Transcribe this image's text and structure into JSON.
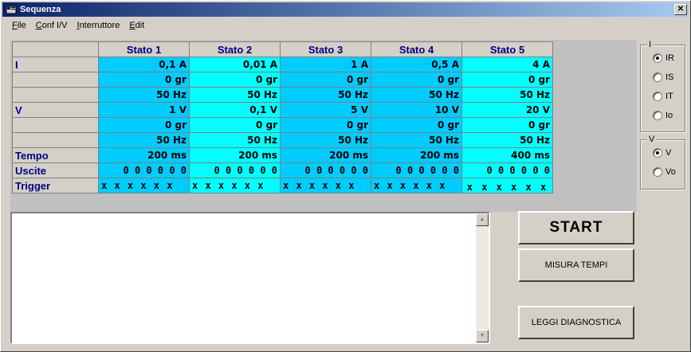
{
  "window": {
    "title": "Sequenza",
    "close_glyph": "✕"
  },
  "menu": [
    {
      "label": "File",
      "mnemonic": "F",
      "rest": "ile"
    },
    {
      "label": "Conf I/V",
      "mnemonic": "C",
      "rest": "onf I/V"
    },
    {
      "label": "Interruttore",
      "mnemonic": "I",
      "rest": "nterruttore"
    },
    {
      "label": "Edit",
      "mnemonic": "E",
      "rest": "dit"
    }
  ],
  "grid": {
    "headers": [
      "Stato 1",
      "Stato 2",
      "Stato 3",
      "Stato 4",
      "Stato 5"
    ],
    "rows": [
      {
        "label": "I",
        "values": [
          "0,1 A",
          "0,01 A",
          "1 A",
          "0,5 A",
          "4 A"
        ]
      },
      {
        "label": "",
        "values": [
          "0 gr",
          "0 gr",
          "0 gr",
          "0 gr",
          "0 gr"
        ]
      },
      {
        "label": "",
        "values": [
          "50 Hz",
          "50 Hz",
          "50 Hz",
          "50 Hz",
          "50 Hz"
        ]
      },
      {
        "label": "V",
        "values": [
          "1 V",
          "0,1 V",
          "5 V",
          "10 V",
          "20 V"
        ]
      },
      {
        "label": "",
        "values": [
          "0 gr",
          "0 gr",
          "0 gr",
          "0 gr",
          "0 gr"
        ]
      },
      {
        "label": "",
        "values": [
          "50 Hz",
          "50 Hz",
          "50 Hz",
          "50 Hz",
          "50 Hz"
        ]
      },
      {
        "label": "Tempo",
        "values": [
          "200 ms",
          "200 ms",
          "200 ms",
          "200 ms",
          "400 ms"
        ]
      },
      {
        "label": "Uscite",
        "values": [
          "0 0 0 0 0 0",
          "0 0 0 0 0 0",
          "0 0 0 0 0 0",
          "0 0 0 0 0 0",
          "0 0 0 0 0 0"
        ]
      },
      {
        "label": "Trigger",
        "values": [
          "x x x x x x",
          "x x x x x x",
          "x x x x x x",
          "x x x x x x",
          "x x x x x x"
        ]
      }
    ],
    "column_colors": [
      "#00ccff",
      "#00ffff",
      "#00ccff",
      "#00ccff",
      "#00ffff"
    ]
  },
  "log": {
    "value": ""
  },
  "buttons": {
    "start": "START",
    "misura": "MISURA TEMPI",
    "leggi": "LEGGI DIAGNOSTICA"
  },
  "group_i": {
    "legend": "I",
    "options": [
      "IR",
      "IS",
      "IT",
      "Io"
    ],
    "selected": "IR"
  },
  "group_v": {
    "legend": "V",
    "options": [
      "V",
      "Vo"
    ],
    "selected": "V"
  }
}
